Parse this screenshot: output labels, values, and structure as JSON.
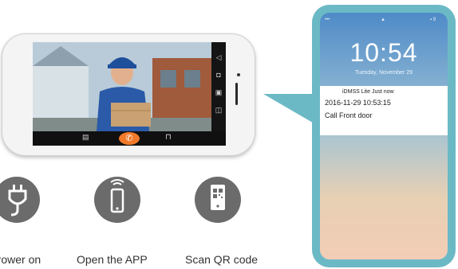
{
  "phone_landscape": {
    "controls": {
      "volume_icon": "speaker-icon",
      "snapshot_icon": "camera-icon",
      "record_icon": "record-icon",
      "gallery_icon": "gallery-icon",
      "answer_icon": "phone-handset-icon",
      "lock_icon": "lock-icon",
      "playback_icon": "playback-icon"
    },
    "colors": {
      "answer_button": "#f07a2a",
      "control_bar": "#141414"
    }
  },
  "phone_portrait": {
    "status_left": "•••",
    "status_center": "▲",
    "status_right": "▪ 9",
    "time": "10:54",
    "date": "Tuesday, November 29",
    "notification": {
      "app_line": "iDMSS Lite  Just now",
      "timestamp": "2016-11-29 10:53:15",
      "message": "Call    Front door"
    },
    "colors": {
      "frame": "#6cb9c6"
    }
  },
  "steps": [
    {
      "label": "Power on",
      "icon": "plug-icon"
    },
    {
      "label": "Open the APP",
      "icon": "smartphone-wifi-icon"
    },
    {
      "label": "Scan QR code",
      "icon": "qr-phone-icon"
    }
  ]
}
